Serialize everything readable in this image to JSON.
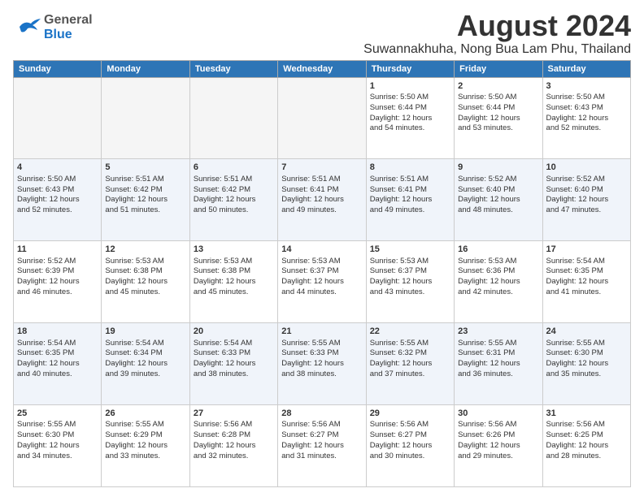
{
  "header": {
    "logo_general": "General",
    "logo_blue": "Blue",
    "title": "August 2024",
    "subtitle": "Suwannakhuha, Nong Bua Lam Phu, Thailand"
  },
  "days_of_week": [
    "Sunday",
    "Monday",
    "Tuesday",
    "Wednesday",
    "Thursday",
    "Friday",
    "Saturday"
  ],
  "weeks": [
    {
      "days": [
        {
          "num": "",
          "info": ""
        },
        {
          "num": "",
          "info": ""
        },
        {
          "num": "",
          "info": ""
        },
        {
          "num": "",
          "info": ""
        },
        {
          "num": "1",
          "info": "Sunrise: 5:50 AM\nSunset: 6:44 PM\nDaylight: 12 hours\nand 54 minutes."
        },
        {
          "num": "2",
          "info": "Sunrise: 5:50 AM\nSunset: 6:44 PM\nDaylight: 12 hours\nand 53 minutes."
        },
        {
          "num": "3",
          "info": "Sunrise: 5:50 AM\nSunset: 6:43 PM\nDaylight: 12 hours\nand 52 minutes."
        }
      ]
    },
    {
      "days": [
        {
          "num": "4",
          "info": "Sunrise: 5:50 AM\nSunset: 6:43 PM\nDaylight: 12 hours\nand 52 minutes."
        },
        {
          "num": "5",
          "info": "Sunrise: 5:51 AM\nSunset: 6:42 PM\nDaylight: 12 hours\nand 51 minutes."
        },
        {
          "num": "6",
          "info": "Sunrise: 5:51 AM\nSunset: 6:42 PM\nDaylight: 12 hours\nand 50 minutes."
        },
        {
          "num": "7",
          "info": "Sunrise: 5:51 AM\nSunset: 6:41 PM\nDaylight: 12 hours\nand 49 minutes."
        },
        {
          "num": "8",
          "info": "Sunrise: 5:51 AM\nSunset: 6:41 PM\nDaylight: 12 hours\nand 49 minutes."
        },
        {
          "num": "9",
          "info": "Sunrise: 5:52 AM\nSunset: 6:40 PM\nDaylight: 12 hours\nand 48 minutes."
        },
        {
          "num": "10",
          "info": "Sunrise: 5:52 AM\nSunset: 6:40 PM\nDaylight: 12 hours\nand 47 minutes."
        }
      ]
    },
    {
      "days": [
        {
          "num": "11",
          "info": "Sunrise: 5:52 AM\nSunset: 6:39 PM\nDaylight: 12 hours\nand 46 minutes."
        },
        {
          "num": "12",
          "info": "Sunrise: 5:53 AM\nSunset: 6:38 PM\nDaylight: 12 hours\nand 45 minutes."
        },
        {
          "num": "13",
          "info": "Sunrise: 5:53 AM\nSunset: 6:38 PM\nDaylight: 12 hours\nand 45 minutes."
        },
        {
          "num": "14",
          "info": "Sunrise: 5:53 AM\nSunset: 6:37 PM\nDaylight: 12 hours\nand 44 minutes."
        },
        {
          "num": "15",
          "info": "Sunrise: 5:53 AM\nSunset: 6:37 PM\nDaylight: 12 hours\nand 43 minutes."
        },
        {
          "num": "16",
          "info": "Sunrise: 5:53 AM\nSunset: 6:36 PM\nDaylight: 12 hours\nand 42 minutes."
        },
        {
          "num": "17",
          "info": "Sunrise: 5:54 AM\nSunset: 6:35 PM\nDaylight: 12 hours\nand 41 minutes."
        }
      ]
    },
    {
      "days": [
        {
          "num": "18",
          "info": "Sunrise: 5:54 AM\nSunset: 6:35 PM\nDaylight: 12 hours\nand 40 minutes."
        },
        {
          "num": "19",
          "info": "Sunrise: 5:54 AM\nSunset: 6:34 PM\nDaylight: 12 hours\nand 39 minutes."
        },
        {
          "num": "20",
          "info": "Sunrise: 5:54 AM\nSunset: 6:33 PM\nDaylight: 12 hours\nand 38 minutes."
        },
        {
          "num": "21",
          "info": "Sunrise: 5:55 AM\nSunset: 6:33 PM\nDaylight: 12 hours\nand 38 minutes."
        },
        {
          "num": "22",
          "info": "Sunrise: 5:55 AM\nSunset: 6:32 PM\nDaylight: 12 hours\nand 37 minutes."
        },
        {
          "num": "23",
          "info": "Sunrise: 5:55 AM\nSunset: 6:31 PM\nDaylight: 12 hours\nand 36 minutes."
        },
        {
          "num": "24",
          "info": "Sunrise: 5:55 AM\nSunset: 6:30 PM\nDaylight: 12 hours\nand 35 minutes."
        }
      ]
    },
    {
      "days": [
        {
          "num": "25",
          "info": "Sunrise: 5:55 AM\nSunset: 6:30 PM\nDaylight: 12 hours\nand 34 minutes."
        },
        {
          "num": "26",
          "info": "Sunrise: 5:55 AM\nSunset: 6:29 PM\nDaylight: 12 hours\nand 33 minutes."
        },
        {
          "num": "27",
          "info": "Sunrise: 5:56 AM\nSunset: 6:28 PM\nDaylight: 12 hours\nand 32 minutes."
        },
        {
          "num": "28",
          "info": "Sunrise: 5:56 AM\nSunset: 6:27 PM\nDaylight: 12 hours\nand 31 minutes."
        },
        {
          "num": "29",
          "info": "Sunrise: 5:56 AM\nSunset: 6:27 PM\nDaylight: 12 hours\nand 30 minutes."
        },
        {
          "num": "30",
          "info": "Sunrise: 5:56 AM\nSunset: 6:26 PM\nDaylight: 12 hours\nand 29 minutes."
        },
        {
          "num": "31",
          "info": "Sunrise: 5:56 AM\nSunset: 6:25 PM\nDaylight: 12 hours\nand 28 minutes."
        }
      ]
    }
  ]
}
